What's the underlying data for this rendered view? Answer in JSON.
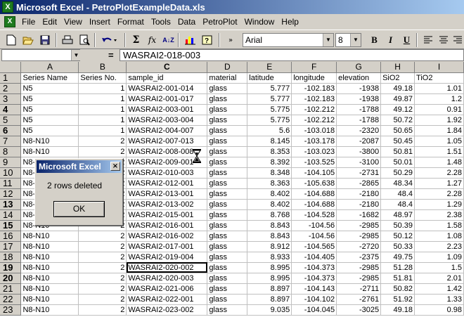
{
  "window": {
    "title": "Microsoft Excel - PetroPlotExampleData.xls"
  },
  "menu": [
    "File",
    "Edit",
    "View",
    "Insert",
    "Format",
    "Tools",
    "Data",
    "PetroPlot",
    "Window",
    "Help"
  ],
  "toolbar": {
    "font_name": "Arial",
    "font_size": "8",
    "bold": "B",
    "italic": "I",
    "underline": "U",
    "sigma": "Σ",
    "fx": "fx",
    "sort": "A↓Z"
  },
  "formula_bar": {
    "name_box": "",
    "equals": "=",
    "content": "WASRAI2-018-003"
  },
  "columns": [
    "A",
    "B",
    "C",
    "D",
    "E",
    "F",
    "G",
    "H",
    "I"
  ],
  "rows": [
    {
      "n": "1",
      "a": "Series Name",
      "b": "Series No.",
      "c": "sample_id",
      "d": "material",
      "e": "latitude",
      "f": "longitude",
      "g": "elevation",
      "h": "SiO2",
      "i": "TiO2"
    },
    {
      "n": "2",
      "a": "N5",
      "b": "1",
      "c": "WASRAI2-001-014",
      "d": "glass",
      "e": "5.777",
      "f": "-102.183",
      "g": "-1938",
      "h": "49.18",
      "i": "1.01"
    },
    {
      "n": "3",
      "a": "N5",
      "b": "1",
      "c": "WASRAI2-001-017",
      "d": "glass",
      "e": "5.777",
      "f": "-102.183",
      "g": "-1938",
      "h": "49.87",
      "i": "1.2"
    },
    {
      "n": "4",
      "a": "N5",
      "b": "1",
      "c": "WASRAI2-003-001",
      "d": "glass",
      "e": "5.775",
      "f": "-102.212",
      "g": "-1788",
      "h": "49.12",
      "i": "0.91"
    },
    {
      "n": "5",
      "a": "N5",
      "b": "1",
      "c": "WASRAI2-003-004",
      "d": "glass",
      "e": "5.775",
      "f": "-102.212",
      "g": "-1788",
      "h": "50.72",
      "i": "1.92"
    },
    {
      "n": "6",
      "a": "N5",
      "b": "1",
      "c": "WASRAI2-004-007",
      "d": "glass",
      "e": "5.6",
      "f": "-103.018",
      "g": "-2320",
      "h": "50.65",
      "i": "1.84"
    },
    {
      "n": "7",
      "a": "N8-N10",
      "b": "2",
      "c": "WASRAI2-007-013",
      "d": "glass",
      "e": "8.145",
      "f": "-103.178",
      "g": "-2087",
      "h": "50.45",
      "i": "1.05"
    },
    {
      "n": "8",
      "a": "N8-N10",
      "b": "2",
      "c": "WASRAI2-008-008",
      "d": "glass",
      "e": "8.353",
      "f": "-103.023",
      "g": "-3800",
      "h": "50.81",
      "i": "1.51"
    },
    {
      "n": "9",
      "a": "N8-N10",
      "b": "2",
      "c": "WASRAI2-009-001",
      "d": "glass",
      "e": "8.392",
      "f": "-103.525",
      "g": "-3100",
      "h": "50.01",
      "i": "1.48"
    },
    {
      "n": "10",
      "a": "N8-N10",
      "b": "2",
      "c": "WASRAI2-010-003",
      "d": "glass",
      "e": "8.348",
      "f": "-104.105",
      "g": "-2731",
      "h": "50.29",
      "i": "2.28"
    },
    {
      "n": "11",
      "a": "N8-N10",
      "b": "2",
      "c": "WASRAI2-012-001",
      "d": "glass",
      "e": "8.363",
      "f": "-105.638",
      "g": "-2865",
      "h": "48.34",
      "i": "1.27"
    },
    {
      "n": "12",
      "a": "N8-N10",
      "b": "2",
      "c": "WASRAI2-013-001",
      "d": "glass",
      "e": "8.402",
      "f": "-104.688",
      "g": "-2180",
      "h": "48.4",
      "i": "2.28"
    },
    {
      "n": "13",
      "a": "N8-N10",
      "b": "2",
      "c": "WASRAI2-013-002",
      "d": "glass",
      "e": "8.402",
      "f": "-104.688",
      "g": "-2180",
      "h": "48.4",
      "i": "1.29"
    },
    {
      "n": "14",
      "a": "N8-N10",
      "b": "2",
      "c": "WASRAI2-015-001",
      "d": "glass",
      "e": "8.768",
      "f": "-104.528",
      "g": "-1682",
      "h": "48.97",
      "i": "2.38"
    },
    {
      "n": "15",
      "a": "N8-N10",
      "b": "2",
      "c": "WASRAI2-016-001",
      "d": "glass",
      "e": "8.843",
      "f": "-104.56",
      "g": "-2985",
      "h": "50.39",
      "i": "1.58"
    },
    {
      "n": "16",
      "a": "N8-N10",
      "b": "2",
      "c": "WASRAI2-016-002",
      "d": "glass",
      "e": "8.843",
      "f": "-104.56",
      "g": "-2985",
      "h": "50.12",
      "i": "1.08"
    },
    {
      "n": "17",
      "a": "N8-N10",
      "b": "2",
      "c": "WASRAI2-017-001",
      "d": "glass",
      "e": "8.912",
      "f": "-104.565",
      "g": "-2720",
      "h": "50.33",
      "i": "2.23"
    },
    {
      "n": "18",
      "a": "N8-N10",
      "b": "2",
      "c": "WASRAI2-019-004",
      "d": "glass",
      "e": "8.933",
      "f": "-104.405",
      "g": "-2375",
      "h": "49.75",
      "i": "1.09"
    },
    {
      "n": "19",
      "a": "N8-N10",
      "b": "2",
      "c": "WASRAI2-020-002",
      "d": "glass",
      "e": "8.995",
      "f": "-104.373",
      "g": "-2985",
      "h": "51.28",
      "i": "1.5"
    },
    {
      "n": "20",
      "a": "N8-N10",
      "b": "2",
      "c": "WASRAI2-020-003",
      "d": "glass",
      "e": "8.995",
      "f": "-104.373",
      "g": "-2985",
      "h": "51.81",
      "i": "2.01"
    },
    {
      "n": "21",
      "a": "N8-N10",
      "b": "2",
      "c": "WASRAI2-021-006",
      "d": "glass",
      "e": "8.897",
      "f": "-104.143",
      "g": "-2711",
      "h": "50.82",
      "i": "1.42"
    },
    {
      "n": "22",
      "a": "N8-N10",
      "b": "2",
      "c": "WASRAI2-022-001",
      "d": "glass",
      "e": "8.897",
      "f": "-104.102",
      "g": "-2761",
      "h": "51.92",
      "i": "1.33"
    },
    {
      "n": "23",
      "a": "N8-N10",
      "b": "2",
      "c": "WASRAI2-023-002",
      "d": "glass",
      "e": "9.035",
      "f": "-104.045",
      "g": "-3025",
      "h": "49.18",
      "i": "0.98"
    }
  ],
  "dialog": {
    "title": "Microsoft Excel",
    "message": "2 rows deleted",
    "ok": "OK",
    "close": "×"
  }
}
